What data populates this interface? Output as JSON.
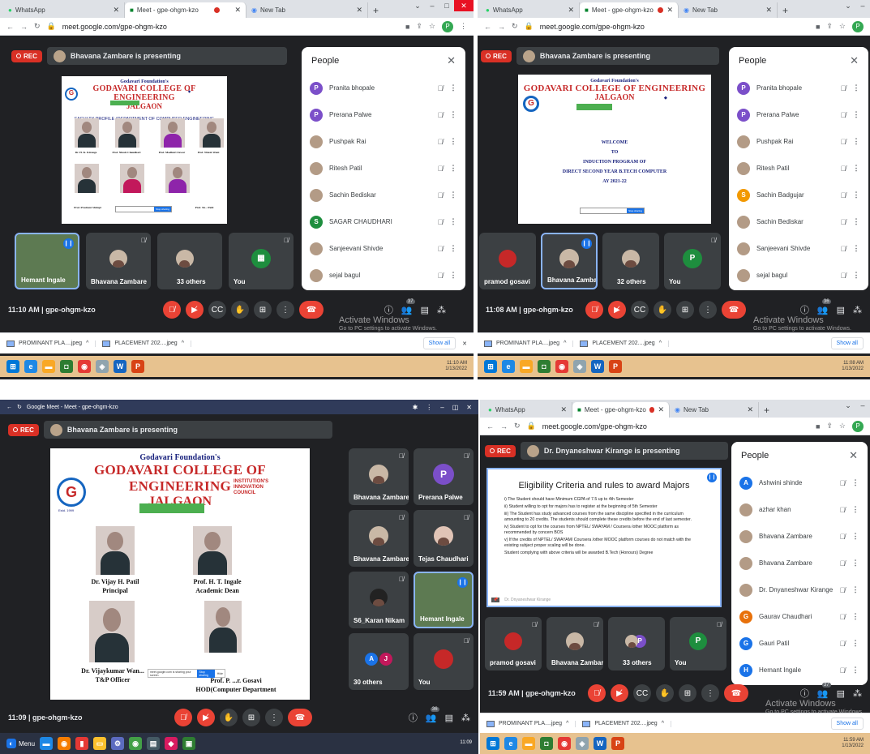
{
  "colors": {
    "meet_bg": "#202124",
    "rec": "#d93025",
    "end_call": "#ea4335",
    "accent": "#1a73e8"
  },
  "q1": {
    "tabs": [
      {
        "label": "WhatsApp",
        "icon": "whatsapp-icon"
      },
      {
        "label": "Meet - gpe-ohgm-kzo",
        "icon": "meet-icon"
      },
      {
        "label": "New Tab",
        "icon": "chrome-icon"
      }
    ],
    "url": "meet.google.com/gpe-ohgm-kzo",
    "rec": "REC",
    "presenting": "Bhavana Zambare is presenting",
    "slide": {
      "foundation": "Godavari Foundation's",
      "college": "GODAVARI COLLEGE OF ENGINEERING",
      "city": "JALGAON",
      "subtitle": "FACULTY PROFILE (DEPARTMENT OF COMPUTER ENGINEERING",
      "faculty": [
        "Dr. H. K. Kirange",
        "Prof. Nitesh Chaudhari",
        "Prof. Madhuri Zawar",
        "Prof. Nitesh Wani",
        "Prof. Prashant Shimpi",
        "",
        "Prof. Sh... Patil"
      ],
      "stop": "Stop sharing"
    },
    "tiles": [
      {
        "name": "Hemant Ingale"
      },
      {
        "name": "Bhavana Zambare"
      },
      {
        "name": "33 others"
      },
      {
        "name": "You"
      }
    ],
    "people_title": "People",
    "people": [
      {
        "name": "Pranita bhopale",
        "initial": "P",
        "color": "#7b4fc9"
      },
      {
        "name": "Prerana Palwe",
        "initial": "P",
        "color": "#7b4fc9"
      },
      {
        "name": "Pushpak Rai",
        "initial": "",
        "color": ""
      },
      {
        "name": "Ritesh Patil",
        "initial": "",
        "color": ""
      },
      {
        "name": "Sachin Bediskar",
        "initial": "",
        "color": ""
      },
      {
        "name": "SAGAR CHAUDHARI",
        "initial": "S",
        "color": "#1e8e3e"
      },
      {
        "name": "Sanjeevani Shivde",
        "initial": "",
        "color": ""
      },
      {
        "name": "sejal bagul",
        "initial": "",
        "color": ""
      }
    ],
    "meeting": "11:10 AM  |  gpe-ohgm-kzo",
    "participant_count": "37",
    "watermark_title": "Activate Windows",
    "watermark_sub": "Go to PC settings to activate Windows.",
    "downloads": [
      "PROMINANT PLA....jpeg",
      "PLACEMENT 202....jpeg"
    ],
    "show_all": "Show all",
    "clock": "11:10 AM",
    "date": "1/13/2022"
  },
  "q2": {
    "tabs": [
      {
        "label": "WhatsApp"
      },
      {
        "label": "Meet - gpe-ohgm-kzo"
      },
      {
        "label": "New Tab"
      }
    ],
    "url": "meet.google.com/gpe-ohgm-kzo",
    "rec": "REC",
    "presenting": "Bhavana Zambare is presenting",
    "slide": {
      "foundation": "Godavari Foundation's",
      "college": "GODAVARI COLLEGE OF ENGINEERING",
      "city": "JALGAON",
      "welcome": [
        "WELCOME",
        "TO",
        "INDUCTION PROGRAM OF",
        "DIRECT SECOND YEAR B.TECH COMPUTER",
        "AY 2021-22"
      ],
      "stop": "Stop sharing"
    },
    "tiles": [
      {
        "name": "pramod gosavi"
      },
      {
        "name": "Bhavana Zambare"
      },
      {
        "name": "32 others"
      },
      {
        "name": "You",
        "initial": "P"
      }
    ],
    "people_title": "People",
    "people": [
      {
        "name": "Pranita bhopale",
        "initial": "P",
        "color": "#7b4fc9"
      },
      {
        "name": "Prerana Palwe",
        "initial": "P",
        "color": "#7b4fc9"
      },
      {
        "name": "Pushpak Rai",
        "initial": "",
        "color": ""
      },
      {
        "name": "Ritesh Patil",
        "initial": "",
        "color": ""
      },
      {
        "name": "Sachin Badgujar",
        "initial": "S",
        "color": "#f29900"
      },
      {
        "name": "Sachin Bediskar",
        "initial": "",
        "color": ""
      },
      {
        "name": "Sanjeevani Shivde",
        "initial": "",
        "color": ""
      },
      {
        "name": "sejal bagul",
        "initial": "",
        "color": ""
      }
    ],
    "meeting": "11:08 AM  |  gpe-ohgm-kzo",
    "participant_count": "36",
    "watermark_title": "Activate Windows",
    "watermark_sub": "Go to PC settings to activate Windows.",
    "downloads": [
      "PROMINANT PLA....jpeg",
      "PLACEMENT 202....jpeg"
    ],
    "show_all": "Show all",
    "clock": "11:08 AM",
    "date": "1/13/2022"
  },
  "q3": {
    "title": "Google Meet - Meet - gpe-ohgm-kzo",
    "rec": "REC",
    "presenting": "Bhavana Zambare is presenting",
    "slide": {
      "foundation": "Godavari Foundation's",
      "college": "GODAVARI COLLEGE OF ENGINEERING",
      "city": "JALGAON",
      "estd": "Estd. 1999",
      "iic": [
        "INSTITUTION'S",
        "INNOVATION",
        "COUNCIL"
      ],
      "people": [
        {
          "name": "Dr. Vijay H. Patil",
          "role": "Principal"
        },
        {
          "name": "Prof. H. T. Ingale",
          "role": "Academic Dean"
        },
        {
          "name": "Dr. Vijaykumar Wan...",
          "role": "T&P Officer"
        },
        {
          "name": "Prof. P. ...r. Gosavi",
          "role": "HOD(Computer Department"
        }
      ],
      "share_note": "meet.google.com is sharing your screen.",
      "stop": "Stop sharing",
      "hide": "Hide"
    },
    "tiles": [
      {
        "name": "Bhavana Zambare"
      },
      {
        "name": "Prerana Palwe",
        "initial": "P"
      },
      {
        "name": "Bhavana Zambare"
      },
      {
        "name": "Tejas Chaudhari"
      },
      {
        "name": "S6_Karan Nikam"
      },
      {
        "name": "Hemant Ingale"
      },
      {
        "name": "30 others",
        "initials": [
          "A",
          "J"
        ]
      },
      {
        "name": "You"
      }
    ],
    "meeting": "11:09  |  gpe-ohgm-kzo",
    "participant_count": "36",
    "menu": "Menu",
    "clock": "11:09"
  },
  "q4": {
    "tabs": [
      {
        "label": "WhatsApp"
      },
      {
        "label": "Meet - gpe-ohgm-kzo"
      },
      {
        "label": "New Tab"
      }
    ],
    "url": "meet.google.com/gpe-ohgm-kzo",
    "rec": "REC",
    "presenting": "Dr. Dnyaneshwar Kirange is presenting",
    "slide": {
      "title": "Eligibility Criteria and rules to award Majors",
      "rules": [
        "i)    The Student should have Minimum CGPA of 7.5 up to 4th Semester",
        "ii) Student willing to opt for majors has to register at the beginning of 5th Semester",
        "iii) The Student has study advanced courses from the same discipline specified in the curriculum amounting to 20 credits. The students should complete these credits before the end of last semester.",
        "iv) Student to opt for the courses from NPTEL/ SWAYAM / Coursera /other MOOC platform as recommended by concern BOS",
        "v) If the credits of NPTEL/ SWAYAM/ Coursera /other MOOC platform courses do not match with the existing subject proper scaling will be done.",
        "Student complying with above criteria will be awarded B.Tech (Honours) Degree"
      ],
      "presenter": "Dr. Dnyaneshwar Kirange"
    },
    "tiles": [
      {
        "name": "pramod gosavi"
      },
      {
        "name": "Bhavana Zambare"
      },
      {
        "name": "33 others",
        "initial": "P"
      },
      {
        "name": "You",
        "initial": "P"
      }
    ],
    "people_title": "People",
    "people": [
      {
        "name": "Ashwini shinde",
        "initial": "A",
        "color": "#1a73e8"
      },
      {
        "name": "azhar khan",
        "initial": "",
        "color": ""
      },
      {
        "name": "Bhavana Zambare",
        "initial": "",
        "color": ""
      },
      {
        "name": "Bhavana Zambare",
        "initial": "",
        "color": ""
      },
      {
        "name": "Dr. Dnyaneshwar Kirange",
        "initial": "",
        "color": ""
      },
      {
        "name": "Gaurav Chaudhari",
        "initial": "G",
        "color": "#e8710a"
      },
      {
        "name": "Gauri Patil",
        "initial": "G",
        "color": "#1a73e8"
      },
      {
        "name": "Hemant Ingale",
        "initial": "H",
        "color": "#1a73e8"
      }
    ],
    "meeting": "11:59 AM  |  gpe-ohgm-kzo",
    "participant_count": "37",
    "watermark_title": "Activate Windows",
    "watermark_sub": "Go to PC settings to activate Windows.",
    "downloads": [
      "PROMINANT PLA....jpeg",
      "PLACEMENT 202....jpeg"
    ],
    "show_all": "Show all",
    "clock": "11:59 AM",
    "date": "1/13/2022"
  }
}
